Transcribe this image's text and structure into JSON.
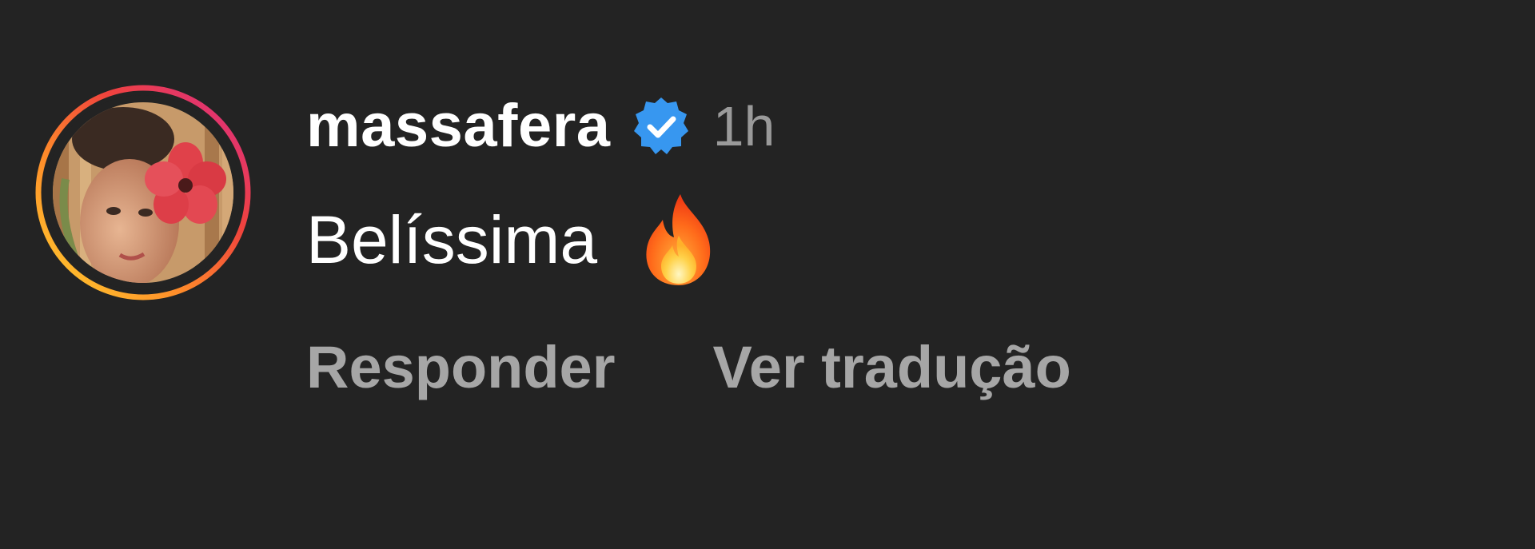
{
  "comment": {
    "username": "massafera",
    "verified_icon": "verified-badge-icon",
    "timestamp": "1h",
    "text": "Belíssima",
    "emoji": "fire-emoji",
    "avatar_ring_colors": [
      "#d92b8c",
      "#f0433d",
      "#ff8c2a",
      "#ffd22e"
    ],
    "verified_color": "#3797f0"
  },
  "actions": {
    "reply_label": "Responder",
    "translate_label": "Ver tradução"
  }
}
